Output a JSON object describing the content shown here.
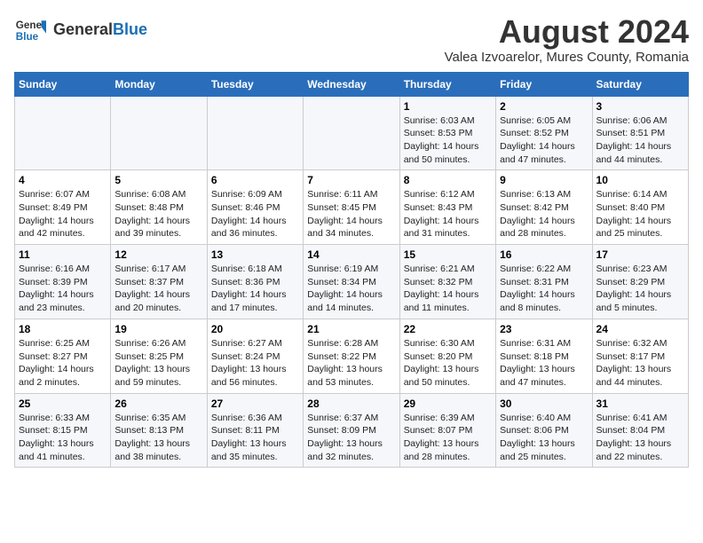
{
  "header": {
    "logo_general": "General",
    "logo_blue": "Blue",
    "main_title": "August 2024",
    "subtitle": "Valea Izvoarelor, Mures County, Romania"
  },
  "weekdays": [
    "Sunday",
    "Monday",
    "Tuesday",
    "Wednesday",
    "Thursday",
    "Friday",
    "Saturday"
  ],
  "weeks": [
    [
      {
        "day": "",
        "content": ""
      },
      {
        "day": "",
        "content": ""
      },
      {
        "day": "",
        "content": ""
      },
      {
        "day": "",
        "content": ""
      },
      {
        "day": "1",
        "content": "Sunrise: 6:03 AM\nSunset: 8:53 PM\nDaylight: 14 hours\nand 50 minutes."
      },
      {
        "day": "2",
        "content": "Sunrise: 6:05 AM\nSunset: 8:52 PM\nDaylight: 14 hours\nand 47 minutes."
      },
      {
        "day": "3",
        "content": "Sunrise: 6:06 AM\nSunset: 8:51 PM\nDaylight: 14 hours\nand 44 minutes."
      }
    ],
    [
      {
        "day": "4",
        "content": "Sunrise: 6:07 AM\nSunset: 8:49 PM\nDaylight: 14 hours\nand 42 minutes."
      },
      {
        "day": "5",
        "content": "Sunrise: 6:08 AM\nSunset: 8:48 PM\nDaylight: 14 hours\nand 39 minutes."
      },
      {
        "day": "6",
        "content": "Sunrise: 6:09 AM\nSunset: 8:46 PM\nDaylight: 14 hours\nand 36 minutes."
      },
      {
        "day": "7",
        "content": "Sunrise: 6:11 AM\nSunset: 8:45 PM\nDaylight: 14 hours\nand 34 minutes."
      },
      {
        "day": "8",
        "content": "Sunrise: 6:12 AM\nSunset: 8:43 PM\nDaylight: 14 hours\nand 31 minutes."
      },
      {
        "day": "9",
        "content": "Sunrise: 6:13 AM\nSunset: 8:42 PM\nDaylight: 14 hours\nand 28 minutes."
      },
      {
        "day": "10",
        "content": "Sunrise: 6:14 AM\nSunset: 8:40 PM\nDaylight: 14 hours\nand 25 minutes."
      }
    ],
    [
      {
        "day": "11",
        "content": "Sunrise: 6:16 AM\nSunset: 8:39 PM\nDaylight: 14 hours\nand 23 minutes."
      },
      {
        "day": "12",
        "content": "Sunrise: 6:17 AM\nSunset: 8:37 PM\nDaylight: 14 hours\nand 20 minutes."
      },
      {
        "day": "13",
        "content": "Sunrise: 6:18 AM\nSunset: 8:36 PM\nDaylight: 14 hours\nand 17 minutes."
      },
      {
        "day": "14",
        "content": "Sunrise: 6:19 AM\nSunset: 8:34 PM\nDaylight: 14 hours\nand 14 minutes."
      },
      {
        "day": "15",
        "content": "Sunrise: 6:21 AM\nSunset: 8:32 PM\nDaylight: 14 hours\nand 11 minutes."
      },
      {
        "day": "16",
        "content": "Sunrise: 6:22 AM\nSunset: 8:31 PM\nDaylight: 14 hours\nand 8 minutes."
      },
      {
        "day": "17",
        "content": "Sunrise: 6:23 AM\nSunset: 8:29 PM\nDaylight: 14 hours\nand 5 minutes."
      }
    ],
    [
      {
        "day": "18",
        "content": "Sunrise: 6:25 AM\nSunset: 8:27 PM\nDaylight: 14 hours\nand 2 minutes."
      },
      {
        "day": "19",
        "content": "Sunrise: 6:26 AM\nSunset: 8:25 PM\nDaylight: 13 hours\nand 59 minutes."
      },
      {
        "day": "20",
        "content": "Sunrise: 6:27 AM\nSunset: 8:24 PM\nDaylight: 13 hours\nand 56 minutes."
      },
      {
        "day": "21",
        "content": "Sunrise: 6:28 AM\nSunset: 8:22 PM\nDaylight: 13 hours\nand 53 minutes."
      },
      {
        "day": "22",
        "content": "Sunrise: 6:30 AM\nSunset: 8:20 PM\nDaylight: 13 hours\nand 50 minutes."
      },
      {
        "day": "23",
        "content": "Sunrise: 6:31 AM\nSunset: 8:18 PM\nDaylight: 13 hours\nand 47 minutes."
      },
      {
        "day": "24",
        "content": "Sunrise: 6:32 AM\nSunset: 8:17 PM\nDaylight: 13 hours\nand 44 minutes."
      }
    ],
    [
      {
        "day": "25",
        "content": "Sunrise: 6:33 AM\nSunset: 8:15 PM\nDaylight: 13 hours\nand 41 minutes."
      },
      {
        "day": "26",
        "content": "Sunrise: 6:35 AM\nSunset: 8:13 PM\nDaylight: 13 hours\nand 38 minutes."
      },
      {
        "day": "27",
        "content": "Sunrise: 6:36 AM\nSunset: 8:11 PM\nDaylight: 13 hours\nand 35 minutes."
      },
      {
        "day": "28",
        "content": "Sunrise: 6:37 AM\nSunset: 8:09 PM\nDaylight: 13 hours\nand 32 minutes."
      },
      {
        "day": "29",
        "content": "Sunrise: 6:39 AM\nSunset: 8:07 PM\nDaylight: 13 hours\nand 28 minutes."
      },
      {
        "day": "30",
        "content": "Sunrise: 6:40 AM\nSunset: 8:06 PM\nDaylight: 13 hours\nand 25 minutes."
      },
      {
        "day": "31",
        "content": "Sunrise: 6:41 AM\nSunset: 8:04 PM\nDaylight: 13 hours\nand 22 minutes."
      }
    ]
  ]
}
